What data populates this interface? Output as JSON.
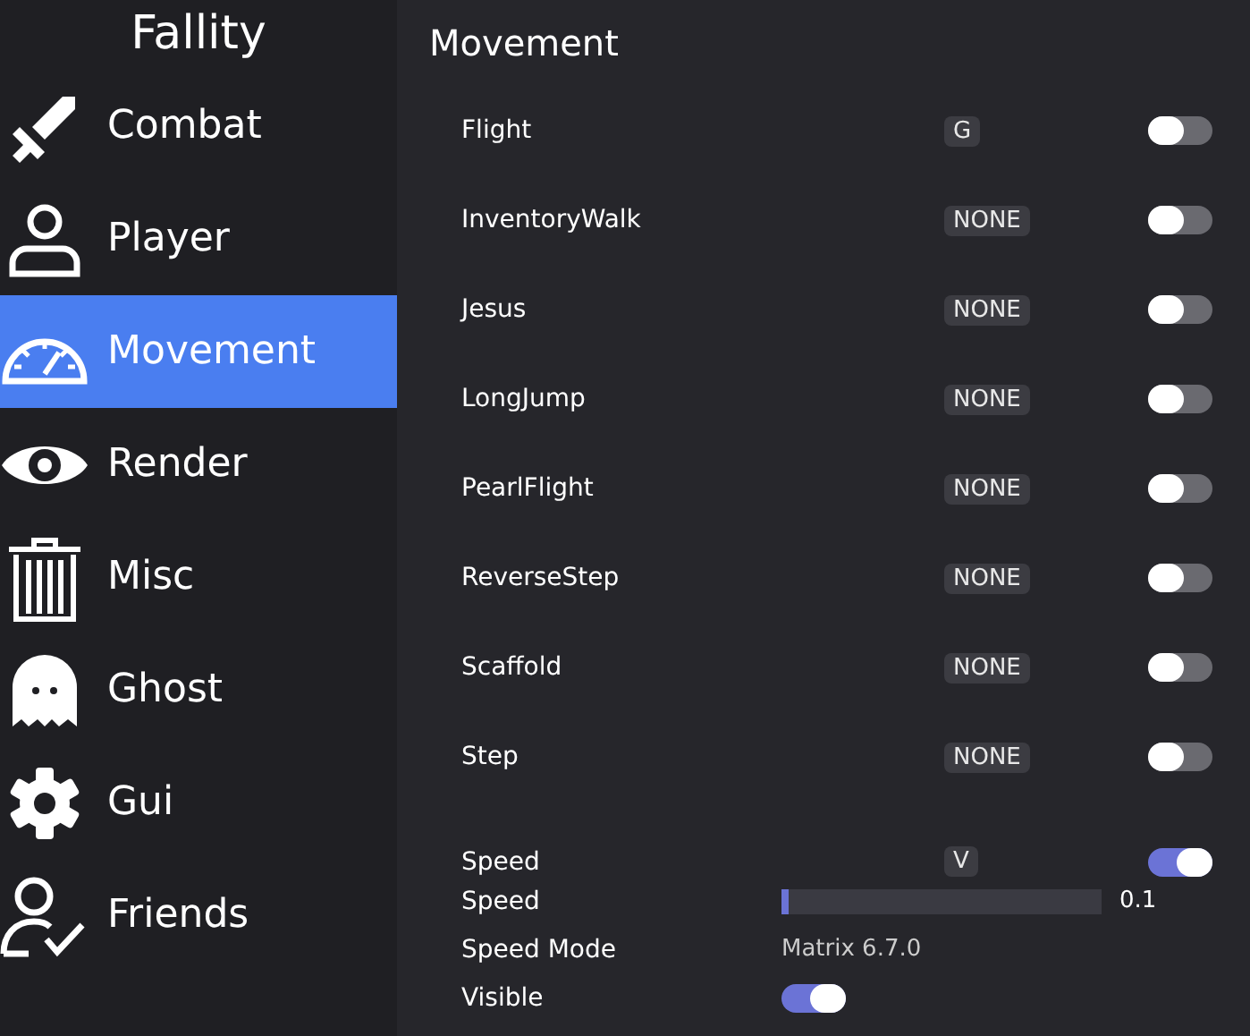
{
  "sidebar": {
    "title": "Fallity",
    "items": [
      {
        "label": "Combat",
        "selected": false
      },
      {
        "label": "Player",
        "selected": false
      },
      {
        "label": "Movement",
        "selected": true
      },
      {
        "label": "Render",
        "selected": false
      },
      {
        "label": "Misc",
        "selected": false
      },
      {
        "label": "Ghost",
        "selected": false
      },
      {
        "label": "Gui",
        "selected": false
      },
      {
        "label": "Friends",
        "selected": false
      }
    ]
  },
  "panel": {
    "title": "Movement",
    "modules": [
      {
        "name": "Flight",
        "bind": "G",
        "on": false
      },
      {
        "name": "InventoryWalk",
        "bind": "NONE",
        "on": false
      },
      {
        "name": "Jesus",
        "bind": "NONE",
        "on": false
      },
      {
        "name": "LongJump",
        "bind": "NONE",
        "on": false
      },
      {
        "name": "PearlFlight",
        "bind": "NONE",
        "on": false
      },
      {
        "name": "ReverseStep",
        "bind": "NONE",
        "on": false
      },
      {
        "name": "Scaffold",
        "bind": "NONE",
        "on": false
      },
      {
        "name": "Step",
        "bind": "NONE",
        "on": false
      },
      {
        "name": "Speed",
        "bind": "V",
        "on": true,
        "settings": [
          {
            "kind": "slider",
            "label": "Speed",
            "level": 0.02,
            "reading": "0.1"
          },
          {
            "kind": "mode",
            "label": "Speed Mode",
            "value": "Matrix 6.7.0"
          },
          {
            "kind": "toggle",
            "label": "Visible",
            "on": true
          }
        ]
      }
    ]
  }
}
